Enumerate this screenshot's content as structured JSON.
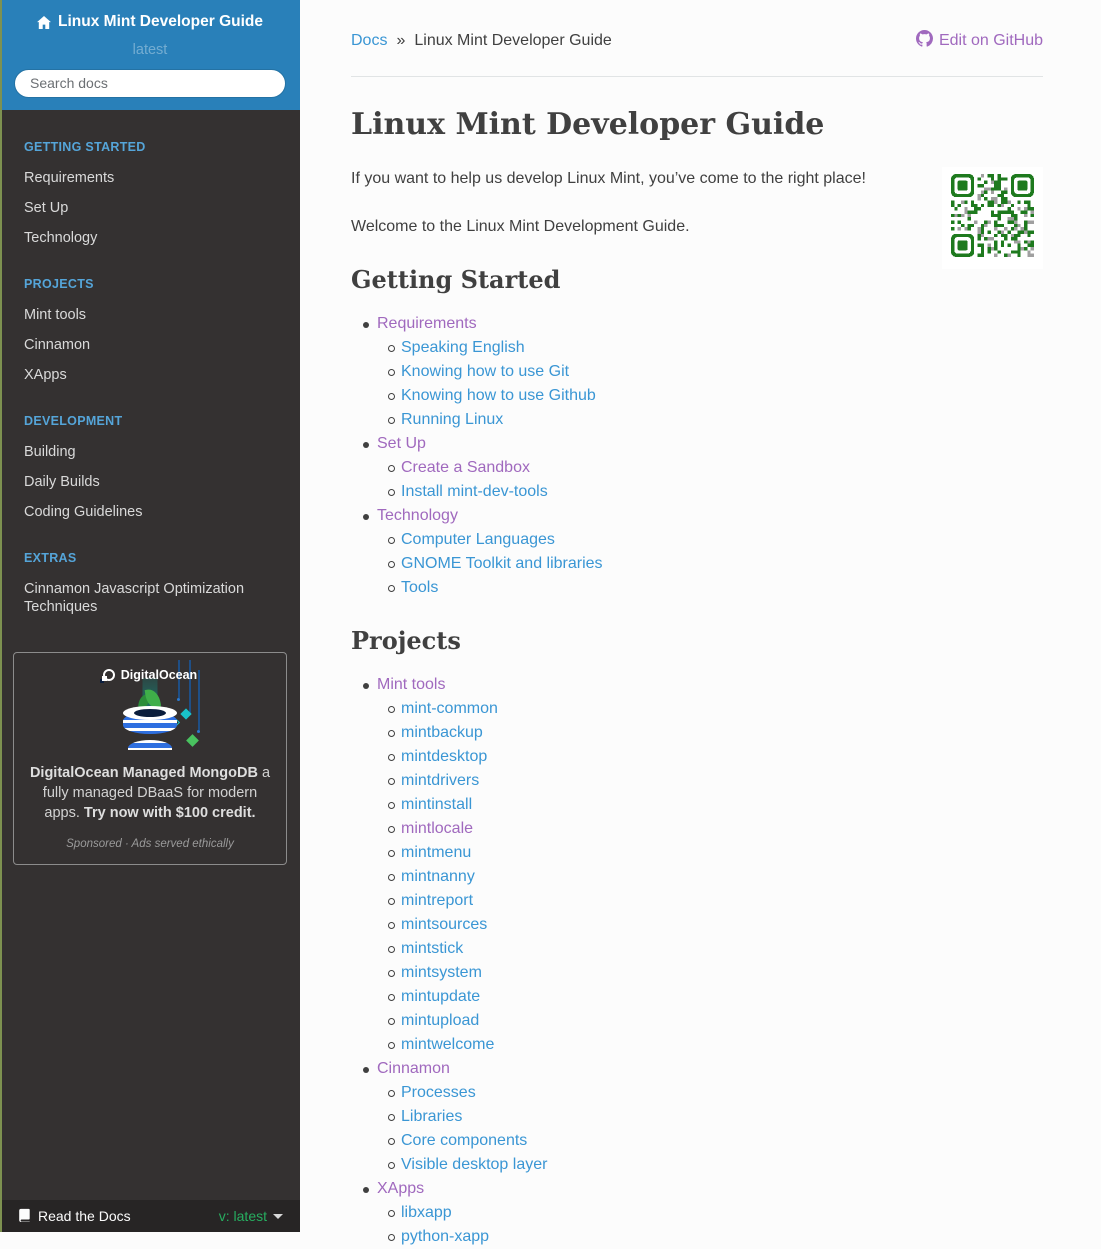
{
  "colors": {
    "header_blue": "#2980b9",
    "sidebar_bg": "#343131",
    "caption_blue": "#55a5d9",
    "sidebar_item": "#d9d9d9",
    "footer_bg": "#272525",
    "version_green": "#27ae60",
    "link_blue": "#3a96d4",
    "link_visited_purple": "#a069be",
    "body_text": "#404040",
    "qr_green": "#1e7a1e",
    "qr_gray": "#a0a0a0"
  },
  "sidebar": {
    "title": "Linux Mint Developer Guide",
    "version": "latest",
    "search_placeholder": "Search docs",
    "sections": [
      {
        "caption": "GETTING STARTED",
        "items": [
          "Requirements",
          "Set Up",
          "Technology"
        ]
      },
      {
        "caption": "PROJECTS",
        "items": [
          "Mint tools",
          "Cinnamon",
          "XApps"
        ]
      },
      {
        "caption": "DEVELOPMENT",
        "items": [
          "Building",
          "Daily Builds",
          "Coding Guidelines"
        ]
      },
      {
        "caption": "EXTRAS",
        "items": [
          "Cinnamon Javascript Optimization Techniques"
        ]
      }
    ],
    "ad": {
      "brand": "DigitalOcean",
      "line1_bold": "DigitalOcean Managed MongoDB",
      "line1_rest": " a fully managed DBaaS for modern apps. ",
      "line2_bold": "Try now with $100 credit.",
      "sponsor": "Sponsored · Ads served ethically"
    },
    "footer": {
      "brand": "Read the Docs",
      "version_label": "v: latest"
    }
  },
  "main": {
    "breadcrumb": {
      "root": "Docs",
      "separator": "»",
      "current": "Linux Mint Developer Guide"
    },
    "edit_link": "Edit on GitHub",
    "title": "Linux Mint Developer Guide",
    "paragraphs": [
      "If you want to help us develop Linux Mint, you’ve come to the right place!",
      "Welcome to the Linux Mint Development Guide."
    ],
    "sections": [
      {
        "heading": "Getting Started",
        "toc": [
          {
            "label": "Requirements",
            "visited": true,
            "children": [
              {
                "label": "Speaking English"
              },
              {
                "label": "Knowing how to use Git"
              },
              {
                "label": "Knowing how to use Github"
              },
              {
                "label": "Running Linux"
              }
            ]
          },
          {
            "label": "Set Up",
            "visited": true,
            "children": [
              {
                "label": "Create a Sandbox",
                "visited": true
              },
              {
                "label": "Install mint-dev-tools"
              }
            ]
          },
          {
            "label": "Technology",
            "visited": true,
            "children": [
              {
                "label": "Computer Languages"
              },
              {
                "label": "GNOME Toolkit and libraries"
              },
              {
                "label": "Tools"
              }
            ]
          }
        ]
      },
      {
        "heading": "Projects",
        "toc": [
          {
            "label": "Mint tools",
            "visited": true,
            "children": [
              {
                "label": "mint-common"
              },
              {
                "label": "mintbackup"
              },
              {
                "label": "mintdesktop"
              },
              {
                "label": "mintdrivers"
              },
              {
                "label": "mintinstall"
              },
              {
                "label": "mintlocale",
                "visited": true
              },
              {
                "label": "mintmenu"
              },
              {
                "label": "mintnanny"
              },
              {
                "label": "mintreport"
              },
              {
                "label": "mintsources"
              },
              {
                "label": "mintstick"
              },
              {
                "label": "mintsystem"
              },
              {
                "label": "mintupdate"
              },
              {
                "label": "mintupload"
              },
              {
                "label": "mintwelcome"
              }
            ]
          },
          {
            "label": "Cinnamon",
            "visited": true,
            "children": [
              {
                "label": "Processes"
              },
              {
                "label": "Libraries"
              },
              {
                "label": "Core components"
              },
              {
                "label": "Visible desktop layer"
              }
            ]
          },
          {
            "label": "XApps",
            "visited": true,
            "children": [
              {
                "label": "libxapp"
              },
              {
                "label": "python-xapp"
              }
            ]
          }
        ]
      }
    ]
  }
}
